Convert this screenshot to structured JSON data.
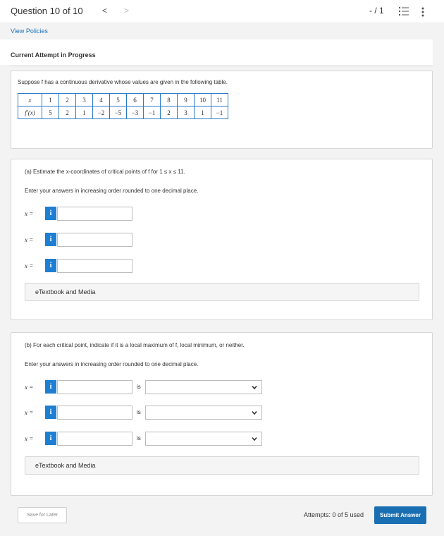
{
  "header": {
    "question_title": "Question 10 of 10",
    "prev_glyph": "<",
    "next_glyph": ">",
    "score": "- / 1"
  },
  "links": {
    "view_policies": "View Policies"
  },
  "attempt": {
    "label": "Current Attempt in Progress"
  },
  "intro": {
    "text": "Suppose f has a continuous derivative whose values are given in the following table.",
    "table": {
      "row1_label": "x",
      "row2_label": "f′(x)",
      "x_values": [
        "1",
        "2",
        "3",
        "4",
        "5",
        "6",
        "7",
        "8",
        "9",
        "10",
        "11"
      ],
      "fprime_values": [
        "5",
        "2",
        "1",
        "−2",
        "−5",
        "−3",
        "−1",
        "2",
        "3",
        "1",
        "−1"
      ]
    }
  },
  "part_a": {
    "prompt": "(a) Estimate the x-coordinates of critical points of f for 1 ≤ x ≤ 11.",
    "instruction": "Enter your answers in increasing order rounded to one decimal place.",
    "x_label": "x =",
    "info_glyph": "i",
    "inputs": [
      {
        "value": "",
        "placeholder": ""
      },
      {
        "value": "",
        "placeholder": ""
      },
      {
        "value": "",
        "placeholder": ""
      }
    ],
    "etextbook": "eTextbook and Media"
  },
  "part_b": {
    "prompt": "(b) For each critical point, indicate if it is a local maximum of f, local minimum, or neither.",
    "instruction": "Enter your answers in increasing order rounded to one decimal place.",
    "x_label": "x =",
    "info_glyph": "i",
    "is_label": "is",
    "rows": [
      {
        "value": "",
        "select_value": ""
      },
      {
        "value": "",
        "select_value": ""
      },
      {
        "value": "",
        "select_value": ""
      }
    ],
    "etextbook": "eTextbook and Media"
  },
  "footer": {
    "save_label": "Save for Later",
    "attempts_text": "Attempts: 0 of 5 used",
    "submit_label": "Submit Answer"
  },
  "colors": {
    "accent": "#1e7fd2",
    "submit": "#1a6fb3",
    "table_border": "#2b7bc8"
  },
  "icons": [
    "list-icon",
    "kebab-menu-icon",
    "info-icon",
    "chevron-down-icon"
  ]
}
